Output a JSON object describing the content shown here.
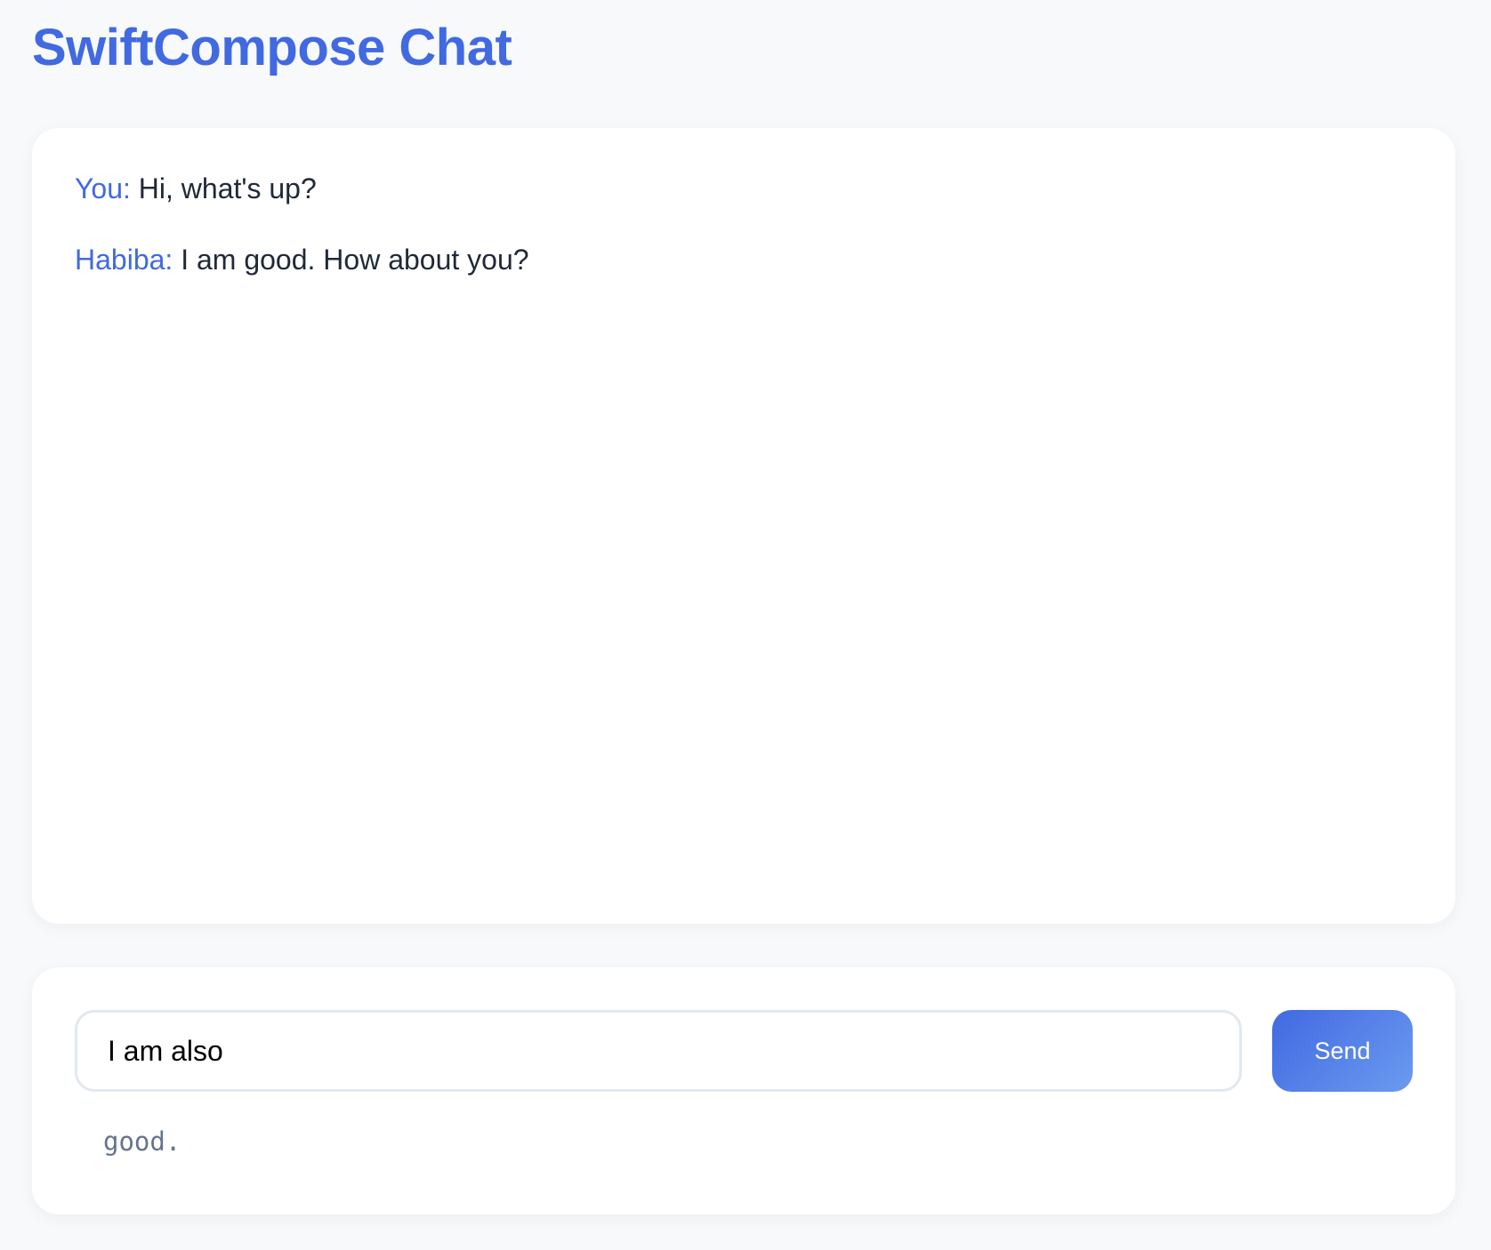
{
  "header": {
    "title": "SwiftCompose Chat"
  },
  "chat": {
    "messages": [
      {
        "sender": "You:",
        "text": "Hi, what's up?"
      },
      {
        "sender": "Habiba:",
        "text": "I am good. How about you?"
      }
    ]
  },
  "composer": {
    "input_value": "I am also",
    "send_label": "Send",
    "suggestion": "good."
  },
  "colors": {
    "accent": "#4169e1",
    "background": "#f7f9fb",
    "panel": "#ffffff",
    "text": "#1f2937",
    "muted": "#64748b"
  }
}
